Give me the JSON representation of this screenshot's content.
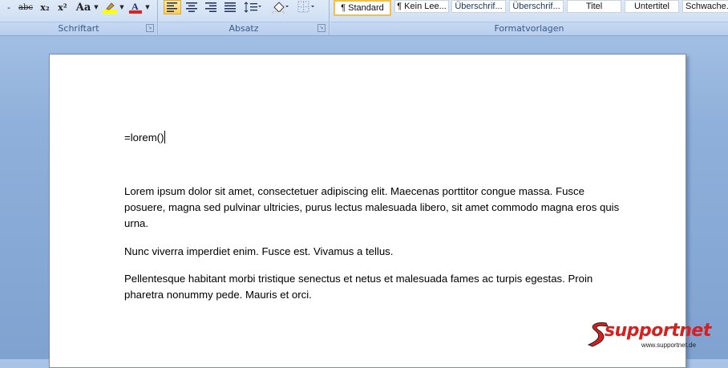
{
  "ribbon": {
    "schriftart": {
      "label": "Schriftart",
      "buttons": [
        "-",
        "abc",
        "x₂",
        "x²",
        "Aa"
      ]
    },
    "absatz": {
      "label": "Absatz"
    },
    "formatvorlagen": {
      "label": "Formatvorlagen",
      "styles": [
        "¶ Standard",
        "¶ Kein Lee...",
        "Überschrif...",
        "Überschrif...",
        "Titel",
        "Untertitel",
        "Schwache..."
      ]
    }
  },
  "document": {
    "command_line": "=lorem()",
    "paragraphs": [
      "Lorem ipsum dolor sit amet, consectetuer adipiscing elit. Maecenas porttitor congue massa. Fusce posuere, magna sed pulvinar ultricies, purus lectus malesuada libero, sit amet commodo magna eros quis urna.",
      "Nunc viverra imperdiet enim. Fusce est. Vivamus a tellus.",
      "Pellentesque habitant morbi tristique senectus et netus et malesuada fames ac turpis egestas. Proin pharetra nonummy pede. Mauris et orci."
    ]
  },
  "watermark": {
    "brand": "supportnet",
    "url": "www.supportnet.de"
  },
  "colors": {
    "highlight": "#ffff00",
    "font_color": "#e0201b",
    "brand_red": "#d61f1f"
  }
}
